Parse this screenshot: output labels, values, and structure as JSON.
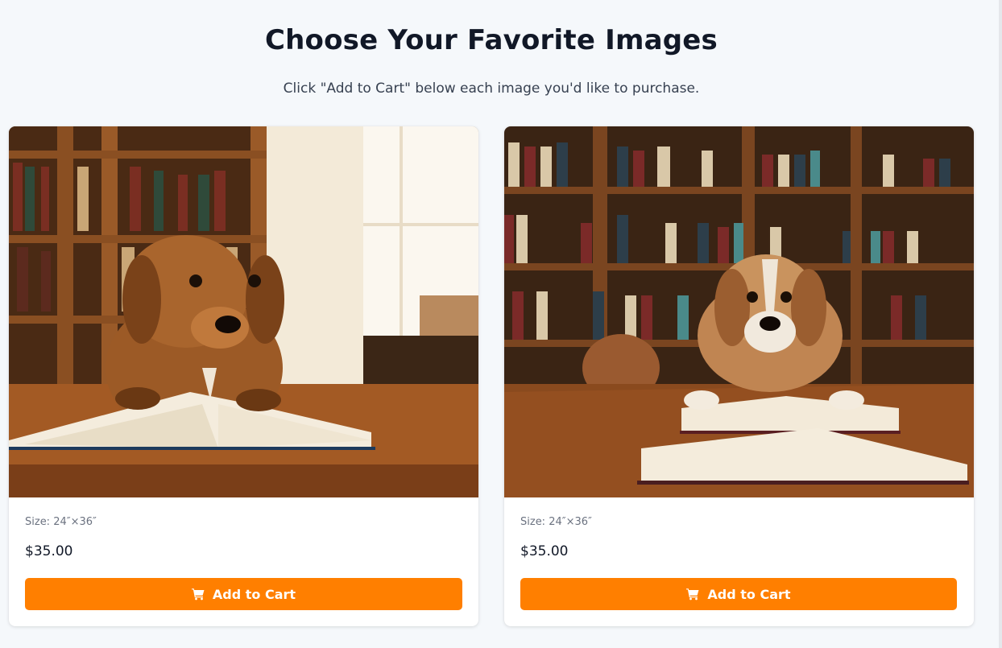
{
  "header": {
    "title": "Choose Your Favorite Images",
    "subtitle": "Click \"Add to Cart\" below each image you'd like to purchase."
  },
  "products": [
    {
      "image_alt": "puppy-reading-book-in-library-1",
      "size": "Size: 24″×36″",
      "price": "$35.00",
      "button_label": "Add to Cart",
      "button_icon": "cart-icon"
    },
    {
      "image_alt": "puppy-reading-book-in-library-2",
      "size": "Size: 24″×36″",
      "price": "$35.00",
      "button_label": "Add to Cart",
      "button_icon": "cart-icon"
    }
  ],
  "colors": {
    "accent": "#ff7f00",
    "background": "#f5f8fb"
  }
}
